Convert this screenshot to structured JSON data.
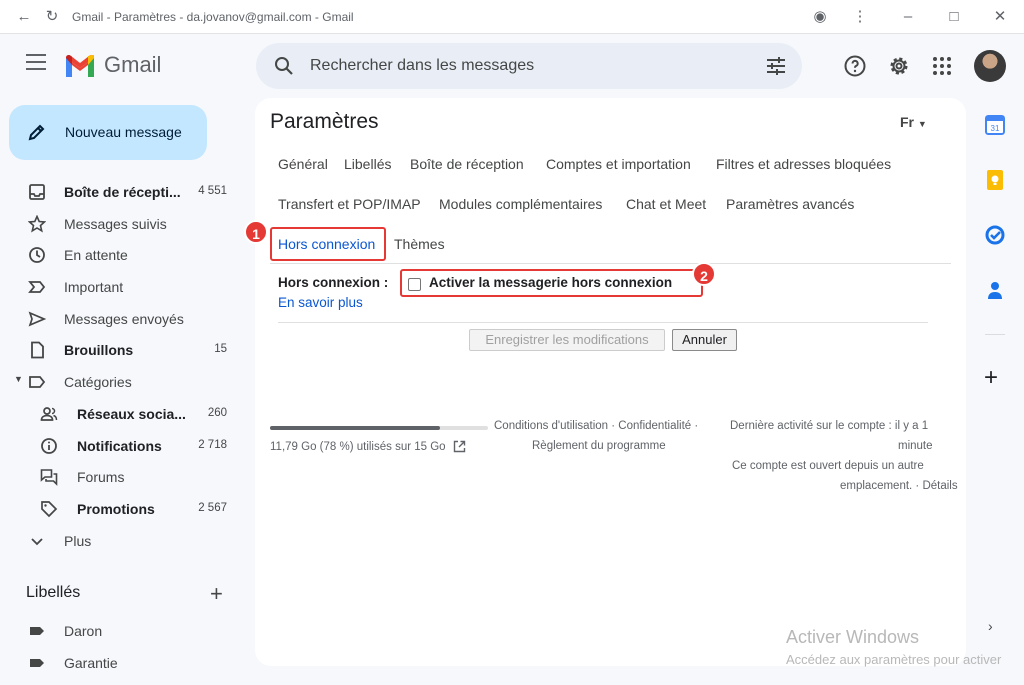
{
  "window": {
    "title": "Gmail - Paramètres - da.jovanov@gmail.com - Gmail"
  },
  "app": {
    "logo_text": "Gmail"
  },
  "search": {
    "placeholder": "Rechercher dans les messages"
  },
  "compose": {
    "label": "Nouveau message"
  },
  "nav": {
    "items": [
      {
        "label": "Boîte de récepti...",
        "count": "4 551",
        "bold": true,
        "icon": "inbox-icon"
      },
      {
        "label": "Messages suivis",
        "count": "",
        "bold": false,
        "icon": "star-icon"
      },
      {
        "label": "En attente",
        "count": "",
        "bold": false,
        "icon": "clock-icon"
      },
      {
        "label": "Important",
        "count": "",
        "bold": false,
        "icon": "important-icon"
      },
      {
        "label": "Messages envoyés",
        "count": "",
        "bold": false,
        "icon": "send-icon"
      },
      {
        "label": "Brouillons",
        "count": "15",
        "bold": true,
        "icon": "draft-icon"
      },
      {
        "label": "Catégories",
        "count": "",
        "bold": false,
        "icon": "label-icon"
      },
      {
        "label": "Réseaux socia...",
        "count": "260",
        "bold": true,
        "icon": "people-icon"
      },
      {
        "label": "Notifications",
        "count": "2 718",
        "bold": true,
        "icon": "info-icon"
      },
      {
        "label": "Forums",
        "count": "",
        "bold": false,
        "icon": "forum-icon"
      },
      {
        "label": "Promotions",
        "count": "2 567",
        "bold": true,
        "icon": "tag-icon"
      },
      {
        "label": "Plus",
        "count": "",
        "bold": false,
        "icon": "chevron-down-icon"
      }
    ],
    "labels_heading": "Libellés",
    "labels": [
      {
        "label": "Daron"
      },
      {
        "label": "Garantie"
      }
    ]
  },
  "settings": {
    "title": "Paramètres",
    "lang_indicator": "Fr",
    "tabs": [
      "Général",
      "Libellés",
      "Boîte de réception",
      "Comptes et importation",
      "Filtres et adresses bloquées",
      "Transfert et POP/IMAP",
      "Modules complémentaires",
      "Chat et Meet",
      "Paramètres avancés",
      "Hors connexion",
      "Thèmes"
    ],
    "active_tab": "Hors connexion",
    "offline_label": "Hors connexion :",
    "learn_more": "En savoir plus",
    "checkbox_label": "Activer la messagerie hors connexion",
    "checkbox_checked": false,
    "save_button": "Enregistrer les modifications",
    "cancel_button": "Annuler",
    "annotations": [
      "1",
      "2"
    ]
  },
  "footer": {
    "storage_fraction": 0.78,
    "storage_text": "11,79 Go (78 %) utilisés sur 15 Go",
    "terms_line1": "Conditions d'utilisation · Confidentialité ·",
    "terms_line2": "Règlement du programme",
    "activity_line1": "Dernière activité sur le compte : il y a 1",
    "activity_line2": "minute",
    "activity_line3": "Ce compte est ouvert depuis un autre",
    "activity_line4": "emplacement. · Détails"
  },
  "watermark": {
    "line1": "Activer Windows",
    "line2": "Accédez aux paramètres pour activer"
  },
  "colors": {
    "accent": "#0b57d0",
    "compose_bg": "#c2e7ff",
    "highlight": "#e53935"
  }
}
